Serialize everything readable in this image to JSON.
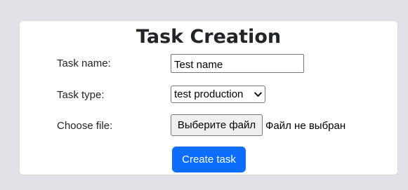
{
  "form": {
    "title": "Task Creation",
    "task_name": {
      "label": "Task name:",
      "value": "Test name"
    },
    "task_type": {
      "label": "Task type:",
      "selected": "test production"
    },
    "file": {
      "label": "Choose file:",
      "button_label": "Выберите файл",
      "status": "Файл не выбран"
    },
    "submit_label": "Create task"
  },
  "icons": {
    "select_arrow": "chevron-down-icon"
  },
  "colors": {
    "page_background": "#e3e1e8",
    "card_background": "#ffffff",
    "primary_button": "#0d6efd",
    "primary_button_text": "#ffffff"
  }
}
